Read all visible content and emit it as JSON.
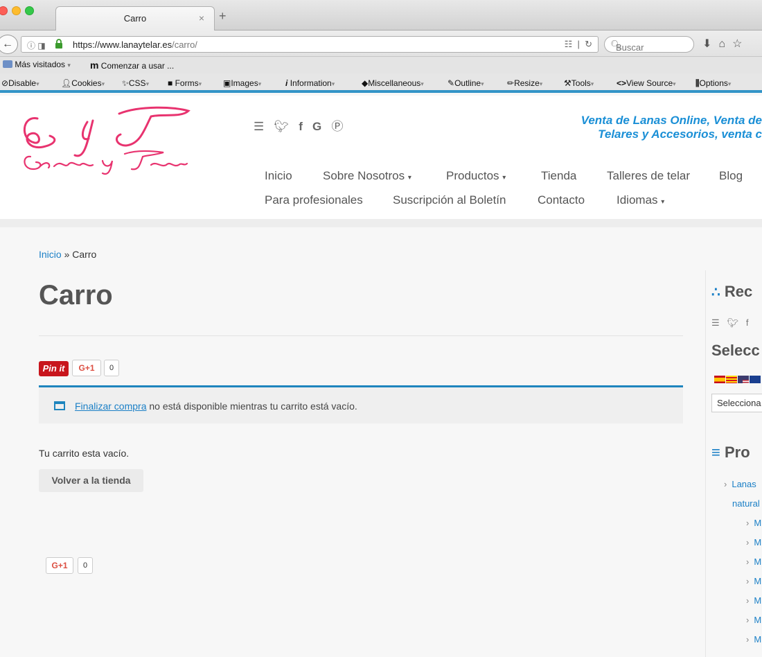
{
  "browser": {
    "tab_title": "Carro",
    "tab_close": "×",
    "new_tab": "+",
    "url_host": "https://www.lanaytelar.es",
    "url_path": "/carro/",
    "search_placeholder": "Buscar"
  },
  "bookmarks": {
    "most_visited": "Más visitados",
    "getting_started": "Comenzar a usar ..."
  },
  "devtools": {
    "disable": "Disable",
    "cookies": "Cookies",
    "css": "CSS",
    "forms": "Forms",
    "images": "Images",
    "information": "Information",
    "miscellaneous": "Miscellaneous",
    "outline": "Outline",
    "resize": "Resize",
    "tools": "Tools",
    "view_source": "View Source",
    "options": "Options"
  },
  "header": {
    "tagline_line1": "Venta de Lanas Online, Venta de",
    "tagline_line2": "Telares y Accesorios, venta c",
    "menu": {
      "inicio": "Inicio",
      "sobre": "Sobre Nosotros",
      "productos": "Productos",
      "tienda": "Tienda",
      "talleres": "Talleres de telar",
      "blog": "Blog",
      "profesionales": "Para profesionales",
      "suscripcion": "Suscripción al Boletín",
      "contacto": "Contacto",
      "idiomas": "Idiomas"
    }
  },
  "breadcrumb": {
    "home": "Inicio",
    "separator": "»",
    "current": "Carro"
  },
  "main": {
    "title": "Carro",
    "pinit_label": "Pin it",
    "gplus_label": "G+1",
    "gplus_count": "0",
    "notice_link": "Finalizar compra",
    "notice_rest": "no está disponible mientras tu carrito está vacío.",
    "empty_text": "Tu carrito esta vacío.",
    "back_button": "Volver a la tienda",
    "bottom_gplus_label": "G+1",
    "bottom_gplus_count": "0"
  },
  "sidebar": {
    "follow_heading": "Rec",
    "select_heading": "Selecc",
    "select_value": "Selecciona",
    "products_heading": "Pro",
    "lanas": "Lanas",
    "naturales": "natural",
    "sub_items": [
      "M",
      "M",
      "M",
      "M",
      "M",
      "M",
      "M"
    ]
  },
  "colors": {
    "accent_blue": "#1a7fc6",
    "brand_pink": "#e8336f",
    "pinit_red": "#c8161d",
    "gplus_red": "#dc4e41"
  }
}
